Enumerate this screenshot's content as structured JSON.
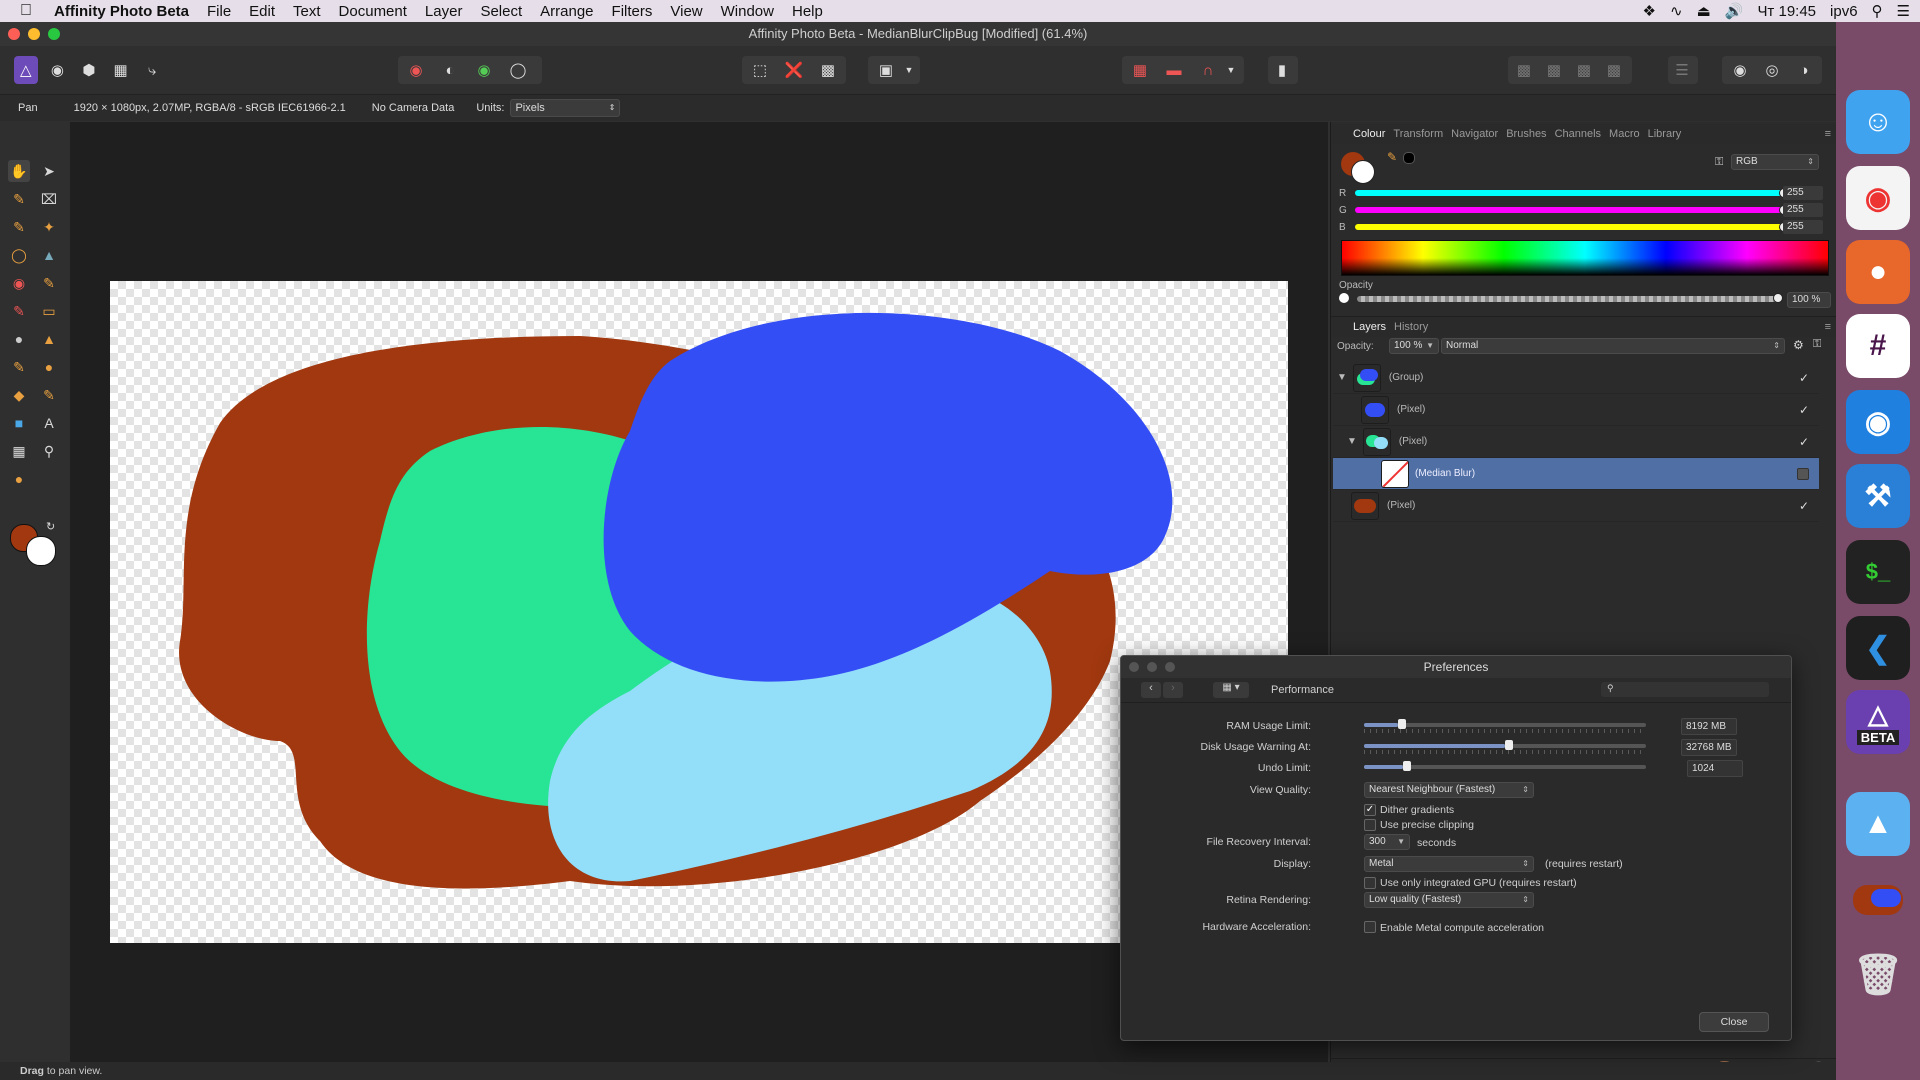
{
  "menubar": {
    "app_name": "Affinity Photo Beta",
    "menus": [
      "File",
      "Edit",
      "Text",
      "Document",
      "Layer",
      "Select",
      "Arrange",
      "Filters",
      "View",
      "Window",
      "Help"
    ],
    "clock": "Чт 19:45",
    "network": "ipv6"
  },
  "window": {
    "title": "Affinity Photo Beta - MedianBlurClipBug [Modified] (61.4%)"
  },
  "context_bar": {
    "tool": "Pan",
    "doc_info": "1920 × 1080px, 2.07MP, RGBA/8 - sRGB IEC61966-2.1",
    "camera": "No Camera Data",
    "units_label": "Units:",
    "units_value": "Pixels"
  },
  "colour_panel": {
    "tabs": [
      "Colour",
      "Transform",
      "Navigator",
      "Brushes",
      "Channels",
      "Macro",
      "Library"
    ],
    "active_tab": "Colour",
    "model": "RGB",
    "channels": [
      {
        "label": "R",
        "value": "255"
      },
      {
        "label": "G",
        "value": "255"
      },
      {
        "label": "B",
        "value": "255"
      }
    ],
    "opacity_label": "Opacity",
    "opacity_value": "100 %"
  },
  "layers_panel": {
    "tabs": [
      "Layers",
      "History"
    ],
    "active_tab": "Layers",
    "opacity_label": "Opacity:",
    "opacity_value": "100 %",
    "blend_mode": "Normal",
    "layers": [
      {
        "name": "(Group)",
        "visible": true
      },
      {
        "name": "(Pixel)",
        "visible": true
      },
      {
        "name": "(Pixel)",
        "visible": true
      },
      {
        "name": "(Median Blur)",
        "visible": false,
        "selected": true
      },
      {
        "name": "(Pixel)",
        "visible": true
      }
    ]
  },
  "preferences": {
    "title": "Preferences",
    "section": "Performance",
    "search_placeholder": "",
    "ram_label": "RAM Usage Limit:",
    "ram_value": "8192 MB",
    "ram_fraction": 0.12,
    "disk_label": "Disk Usage Warning At:",
    "disk_value": "32768 MB",
    "disk_fraction": 0.5,
    "undo_label": "Undo Limit:",
    "undo_value": "1024",
    "undo_fraction": 0.14,
    "view_quality_label": "View Quality:",
    "view_quality_value": "Nearest Neighbour (Fastest)",
    "dither_label": "Dither gradients",
    "dither_checked": true,
    "precise_clip_label": "Use precise clipping",
    "precise_clip_checked": false,
    "recovery_label": "File Recovery Interval:",
    "recovery_value": "300",
    "recovery_unit": "seconds",
    "display_label": "Display:",
    "display_value": "Metal",
    "display_note": "(requires restart)",
    "integrated_gpu_label": "Use only integrated GPU (requires restart)",
    "retina_label": "Retina Rendering:",
    "retina_value": "Low quality (Fastest)",
    "hw_label": "Hardware Acceleration:",
    "hw_checkbox_label": "Enable Metal compute acceleration",
    "close_label": "Close"
  },
  "status": {
    "bold": "Drag",
    "text": " to pan view."
  },
  "dock": {
    "beta_label": "BETA"
  },
  "colors": {
    "brown": "#a1380f",
    "blue": "#344ef5",
    "green": "#27e594",
    "light_blue": "#93def9",
    "accent": "#4f6fa5"
  }
}
